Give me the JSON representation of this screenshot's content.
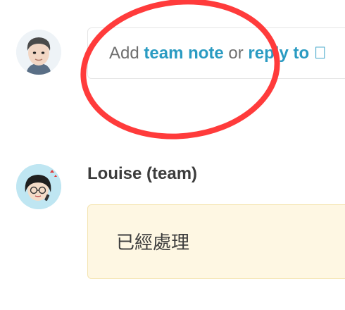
{
  "composer": {
    "prefix": "Add",
    "team_note_link": "team note",
    "separator": "or",
    "reply_link": "reply to 𧅴"
  },
  "message": {
    "author": "Louise (team)",
    "body": "已經處理"
  },
  "colors": {
    "link": "#2a9bc2",
    "note_background": "#fef7e3",
    "annotation": "#ff3b3b"
  }
}
